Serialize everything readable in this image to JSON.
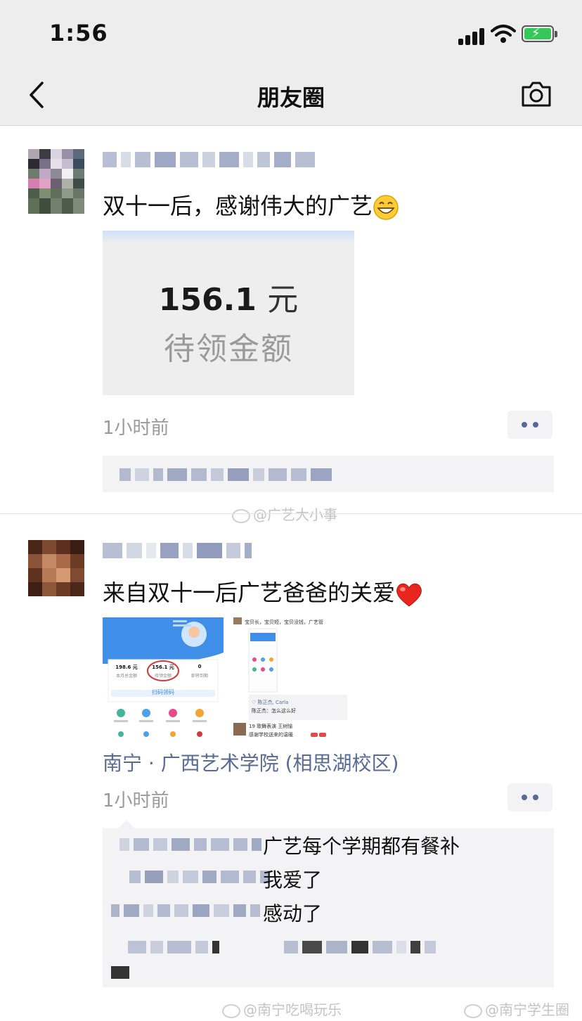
{
  "status": {
    "time": "1:56"
  },
  "nav": {
    "title": "朋友圈"
  },
  "posts": [
    {
      "text": "双十一后，感谢伟大的广艺",
      "image": {
        "amount": "156.1",
        "unit": "元",
        "label": "待领金额"
      },
      "time": "1小时前"
    },
    {
      "text": "来自双十一后广艺爸爸的关爱",
      "location": "南宁 · 广西艺术学院 (相思湖校区)",
      "time": "1小时前",
      "comments": [
        "广艺每个学期都有餐补",
        "我爱了",
        "感动了"
      ]
    }
  ],
  "watermarks": [
    "@广艺大小事",
    "@南宁吃喝玩乐",
    "@南宁学生圈"
  ],
  "thumb1": {
    "stat1": "198.6 元",
    "stat2": "156.1 元",
    "stat3": "0",
    "cap1": "本月总金额",
    "cap2": "待领金额",
    "cap3": "即将到期",
    "action": "扫码领码"
  },
  "thumb2": {
    "header": "宝贝长，宝贝短，宝贝没钱，广艺管",
    "line1": "♡ 陈正杰, Carla",
    "line2": "陈正杰：怎么这么好",
    "line3": "19 歌舞表演 王树愉",
    "line4": "感谢学校送来的温暖"
  },
  "colors": {
    "link": "#576b95",
    "navbar": "#ededed",
    "meta": "#9a9a9a",
    "battery": "#35c759"
  }
}
